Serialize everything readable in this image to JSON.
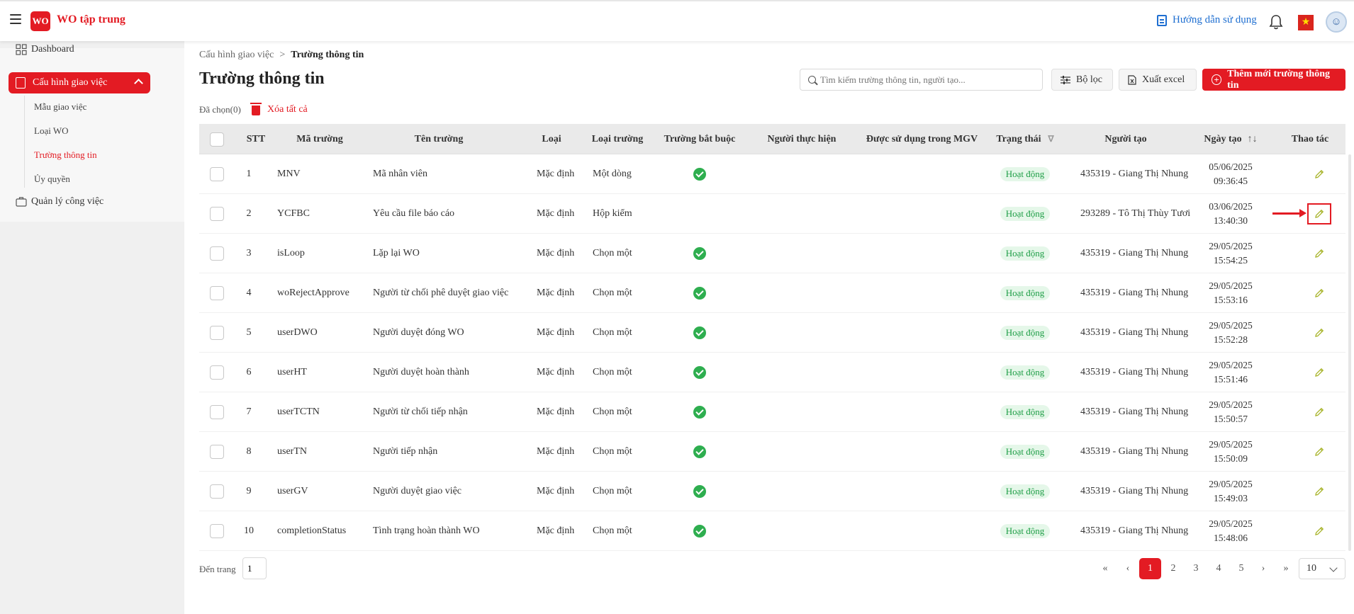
{
  "app": {
    "title": "WO tập trung",
    "logo_text": "WO"
  },
  "header": {
    "guide_label": "Hướng dẫn sử dụng",
    "flag_symbol": "★",
    "avatar_symbol": "☺"
  },
  "sidebar": {
    "dashboard": "Dashboard",
    "config": "Cấu hình giao việc",
    "sub": [
      "Mẫu giao việc",
      "Loại WO",
      "Trường thông tin",
      "Ủy quyền"
    ],
    "manage": "Quản lý công việc"
  },
  "breadcrumb": {
    "parent": "Cấu hình giao việc",
    "separator": ">",
    "current": "Trường thông tin"
  },
  "page_title": "Trường thông tin",
  "search": {
    "placeholder": "Tìm kiếm trường thông tin, người tạo...",
    "value": ""
  },
  "toolbar": {
    "filter": "Bộ lọc",
    "excel": "Xuất excel",
    "add": "Thêm mới trường thông tin"
  },
  "selection": {
    "selected": "Đã chọn(0)",
    "clear_all": "Xóa tất cả"
  },
  "table": {
    "headers": {
      "stt": "STT",
      "code": "Mã trường",
      "name": "Tên trường",
      "type": "Loại",
      "field_type": "Loại trường",
      "required": "Trường bắt buộc",
      "executor": "Người thực hiện",
      "used": "Được sử dụng trong MGV",
      "status": "Trạng thái",
      "creator": "Người tạo",
      "created": "Ngày tạo",
      "actions": "Thao tác"
    },
    "sort_icon": "↑↓",
    "filter_icon": "∇",
    "rows": [
      {
        "stt": "1",
        "code": "MNV",
        "name": "Mã nhân viên",
        "type": "Mặc định",
        "field_type": "Một dòng",
        "required": true,
        "status": "Hoạt động",
        "creator": "435319 - Giang Thị Nhung",
        "date": "05/06/2025",
        "time": "09:36:45"
      },
      {
        "stt": "2",
        "code": "YCFBC",
        "name": "Yêu cầu file báo cáo",
        "type": "Mặc định",
        "field_type": "Hộp kiểm",
        "required": false,
        "status": "Hoạt động",
        "creator": "293289 - Tô Thị Thùy Tươi",
        "date": "03/06/2025",
        "time": "13:40:30"
      },
      {
        "stt": "3",
        "code": "isLoop",
        "name": "Lặp lại WO",
        "type": "Mặc định",
        "field_type": "Chọn một",
        "required": true,
        "status": "Hoạt động",
        "creator": "435319 - Giang Thị Nhung",
        "date": "29/05/2025",
        "time": "15:54:25"
      },
      {
        "stt": "4",
        "code": "woRejectApprove",
        "name": "Người từ chối phê duyệt giao việc",
        "type": "Mặc định",
        "field_type": "Chọn một",
        "required": true,
        "status": "Hoạt động",
        "creator": "435319 - Giang Thị Nhung",
        "date": "29/05/2025",
        "time": "15:53:16"
      },
      {
        "stt": "5",
        "code": "userDWO",
        "name": "Người duyệt đóng WO",
        "type": "Mặc định",
        "field_type": "Chọn một",
        "required": true,
        "status": "Hoạt động",
        "creator": "435319 - Giang Thị Nhung",
        "date": "29/05/2025",
        "time": "15:52:28"
      },
      {
        "stt": "6",
        "code": "userHT",
        "name": "Người duyệt hoàn thành",
        "type": "Mặc định",
        "field_type": "Chọn một",
        "required": true,
        "status": "Hoạt động",
        "creator": "435319 - Giang Thị Nhung",
        "date": "29/05/2025",
        "time": "15:51:46"
      },
      {
        "stt": "7",
        "code": "userTCTN",
        "name": "Người từ chối tiếp nhận",
        "type": "Mặc định",
        "field_type": "Chọn một",
        "required": true,
        "status": "Hoạt động",
        "creator": "435319 - Giang Thị Nhung",
        "date": "29/05/2025",
        "time": "15:50:57"
      },
      {
        "stt": "8",
        "code": "userTN",
        "name": "Người tiếp nhận",
        "type": "Mặc định",
        "field_type": "Chọn một",
        "required": true,
        "status": "Hoạt động",
        "creator": "435319 - Giang Thị Nhung",
        "date": "29/05/2025",
        "time": "15:50:09"
      },
      {
        "stt": "9",
        "code": "userGV",
        "name": "Người duyệt giao việc",
        "type": "Mặc định",
        "field_type": "Chọn một",
        "required": true,
        "status": "Hoạt động",
        "creator": "435319 - Giang Thị Nhung",
        "date": "29/05/2025",
        "time": "15:49:03"
      },
      {
        "stt": "10",
        "code": "completionStatus",
        "name": "Tình trạng hoàn thành WO",
        "type": "Mặc định",
        "field_type": "Chọn một",
        "required": true,
        "status": "Hoạt động",
        "creator": "435319 - Giang Thị Nhung",
        "date": "29/05/2025",
        "time": "15:48:06"
      }
    ]
  },
  "pagination": {
    "goto_label": "Đến trang",
    "goto_value": "1",
    "first": "«",
    "prev": "‹",
    "next": "›",
    "last": "»",
    "pages": [
      "1",
      "2",
      "3",
      "4",
      "5"
    ],
    "current": "1",
    "per_page": "10"
  },
  "colors": {
    "primary": "#e31b23",
    "success": "#2eae4f",
    "link": "#1f6fd1"
  }
}
